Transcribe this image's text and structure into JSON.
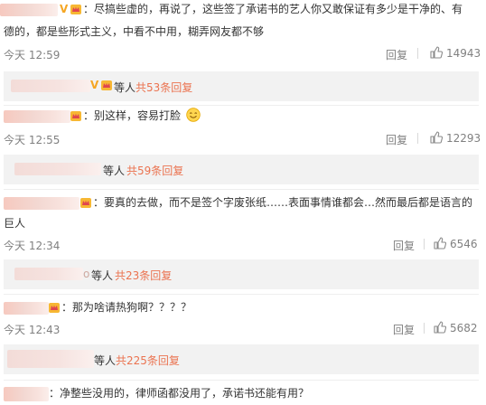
{
  "comments": [
    {
      "text_line1": "：尽搞些虚的，再说了，这些签了承诺书的艺人你又敢保证有多少是干净的、有",
      "text_line2": "德的，都是些形式主义，中看不中用，糊弄网友都不够",
      "time": "今天 12:59",
      "reply_label": "回复",
      "likes": "14943",
      "reply_summary": {
        "who": "等人",
        "more": "共53条回复"
      }
    },
    {
      "text_line1": "：别这样，容易打脸",
      "time": "今天 12:55",
      "reply_label": "回复",
      "likes": "12293",
      "reply_summary": {
        "who": "等人",
        "more": "共59条回复"
      }
    },
    {
      "text_line1": "：要真的去做，而不是签个字废张纸……表面事情谁都会…然而最后都是语言的",
      "text_line2": "巨人",
      "time": "今天 12:34",
      "reply_label": "回复",
      "likes": "6546",
      "reply_summary": {
        "who_prefix": "o",
        "who": "等人",
        "more": "共23条回复"
      }
    },
    {
      "text_line1": "：那为啥请热狗啊？？？？",
      "time": "今天 12:43",
      "reply_label": "回复",
      "likes": "5682",
      "reply_summary": {
        "who": "等人",
        "more": "共225条回复"
      }
    },
    {
      "text_line1": "：净整些没用的，律师函都没用了，承诺书还能有用？"
    }
  ],
  "colors": {
    "accent": "#eb7350",
    "muted": "#808080",
    "reply_bg": "#f2f2f2"
  },
  "icons": [
    "vip-v-icon",
    "crown-badge-icon",
    "thumbs-up-icon",
    "smiley-emoji-icon"
  ]
}
